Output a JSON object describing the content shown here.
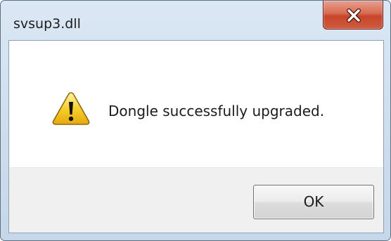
{
  "window": {
    "title": "svsup3.dll"
  },
  "titlebar": {
    "close_icon": "close-icon"
  },
  "dialog": {
    "icon": "warning-icon",
    "message": "Dongle successfully upgraded.",
    "ok_label": "OK"
  },
  "colors": {
    "close_button": "#c6452a",
    "warning_yellow": "#f5c518",
    "frame": "#cfdeee"
  }
}
